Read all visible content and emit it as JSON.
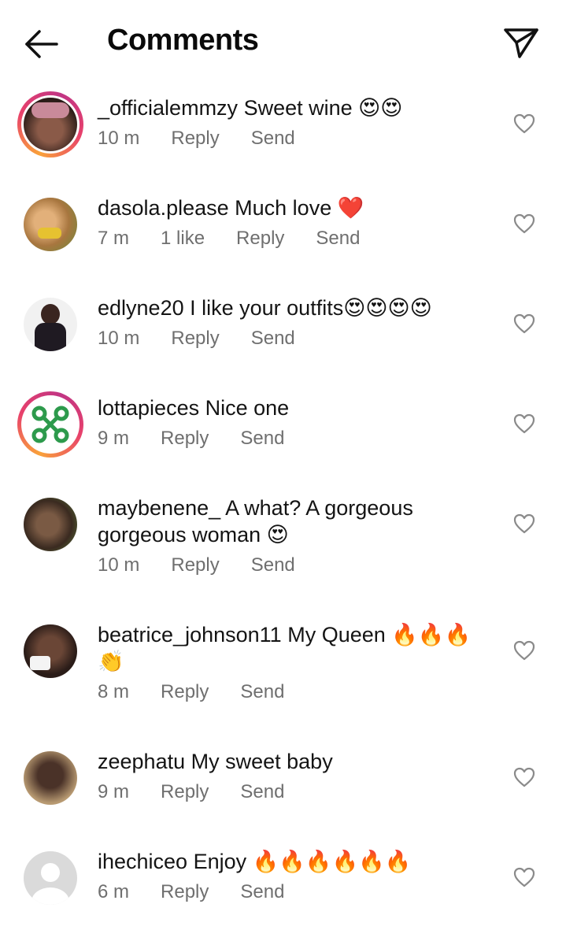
{
  "header": {
    "title": "Comments",
    "back_icon": "arrow-left-icon",
    "share_icon": "paper-plane-icon"
  },
  "comments": [
    {
      "username": "_officialemmzy",
      "text": "Sweet wine 😍😍",
      "time": "10 m",
      "likes": "",
      "reply": "Reply",
      "send": "Send",
      "story_ring": true,
      "avatar_color": "#5a3b2e"
    },
    {
      "username": "dasola.please",
      "text": "Much love ❤️",
      "time": "7 m",
      "likes": "1 like",
      "reply": "Reply",
      "send": "Send",
      "story_ring": false,
      "avatar_color": "#c58a4a"
    },
    {
      "username": "edlyne20",
      "text": "I like your outfits😍😍😍😍",
      "time": "10 m",
      "likes": "",
      "reply": "Reply",
      "send": "Send",
      "story_ring": false,
      "avatar_color": "#3a2a28"
    },
    {
      "username": "lottapieces",
      "text": "Nice one",
      "time": "9 m",
      "likes": "",
      "reply": "Reply",
      "send": "Send",
      "story_ring": true,
      "avatar_color": "#2f9a4a"
    },
    {
      "username": "maybenene_",
      "text": "A what? A gorgeous gorgeous woman 😍",
      "time": "10 m",
      "likes": "",
      "reply": "Reply",
      "send": "Send",
      "story_ring": false,
      "avatar_color": "#4a3a2a"
    },
    {
      "username": "beatrice_johnson11",
      "text": "My Queen 🔥🔥🔥👏",
      "time": "8 m",
      "likes": "",
      "reply": "Reply",
      "send": "Send",
      "story_ring": false,
      "avatar_color": "#3b2b26"
    },
    {
      "username": "zeephatu",
      "text": "My sweet baby",
      "time": "9 m",
      "likes": "",
      "reply": "Reply",
      "send": "Send",
      "story_ring": false,
      "avatar_color": "#6b5a4a"
    },
    {
      "username": "ihechiceo",
      "text": "Enjoy 🔥🔥🔥🔥🔥🔥",
      "time": "6 m",
      "likes": "",
      "reply": "Reply",
      "send": "Send",
      "story_ring": false,
      "avatar_color": "#dcdcdc"
    }
  ],
  "like_icon": "heart-outline-icon"
}
